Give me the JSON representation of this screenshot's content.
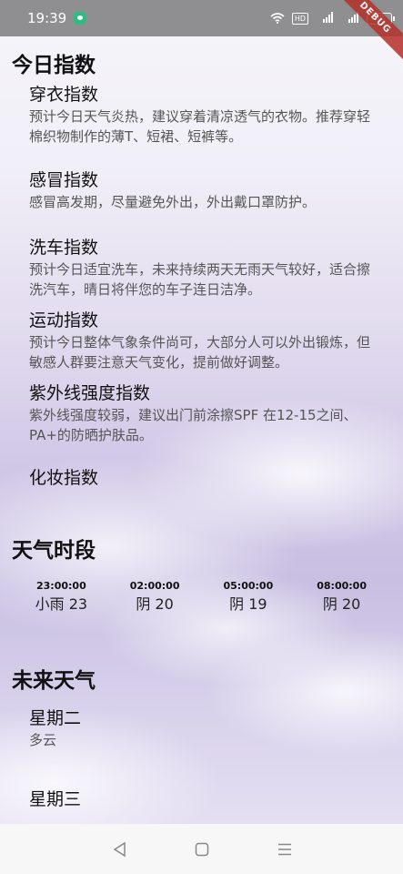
{
  "status": {
    "time": "19:39",
    "hd": "HD",
    "signal1": "4G",
    "signal2": "4G",
    "battery": "50",
    "debug": "DEBUG"
  },
  "sections": {
    "today_index": "今日指数",
    "hourly": "天气时段",
    "future": "未来天气"
  },
  "indices": [
    {
      "name": "穿衣指数",
      "desc": "预计今日天气炎热，建议穿着清凉透气的衣物。推荐穿轻棉织物制作的薄T、短裙、短裤等。"
    },
    {
      "name": "感冒指数",
      "desc": "感冒高发期，尽量避免外出，外出戴口罩防护。"
    },
    {
      "name": "洗车指数",
      "desc": "预计今日适宜洗车，未来持续两天无雨天气较好，适合擦洗汽车，晴日将伴您的车子连日洁净。"
    },
    {
      "name": "运动指数",
      "desc": "预计今日整体气象条件尚可，大部分人可以外出锻炼，但敏感人群要注意天气变化，提前做好调整。"
    },
    {
      "name": "紫外线强度指数",
      "desc": "紫外线强度较弱，建议出门前涂擦SPF 在12-15之间、PA+的防晒护肤品。"
    },
    {
      "name": "化妆指数",
      "desc": ""
    }
  ],
  "hourly": [
    {
      "time": "23:00:00",
      "weather": "小雨 23"
    },
    {
      "time": "02:00:00",
      "weather": "阴 20"
    },
    {
      "time": "05:00:00",
      "weather": "阴 19"
    },
    {
      "time": "08:00:00",
      "weather": "阴 20"
    }
  ],
  "future": [
    {
      "day": "星期二",
      "weather": "多云"
    },
    {
      "day": "星期三",
      "weather": ""
    }
  ],
  "nav": {
    "back": "back-icon",
    "home": "home-icon",
    "recents": "menu-icon"
  }
}
